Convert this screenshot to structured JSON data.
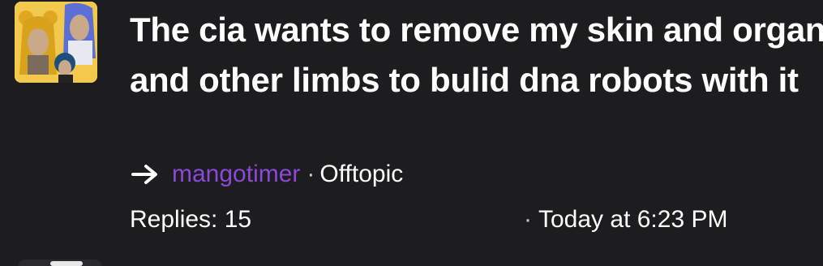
{
  "thread": {
    "title": "The cia wants to remove my skin and organs and other limbs to bulid dna robots with it",
    "author": "mangotimer",
    "separator": "·",
    "forum": "Offtopic",
    "replies_label": "Replies: 15",
    "timestamp_separator": "·",
    "timestamp": "Today at 6:23 PM"
  },
  "icons": {
    "arrow": "arrow-right-icon",
    "avatar": "user-avatar"
  },
  "colors": {
    "background": "#1d1d1f",
    "author": "#8b48d9",
    "text": "#ffffff",
    "avatar_bg": "#f2c94c"
  }
}
